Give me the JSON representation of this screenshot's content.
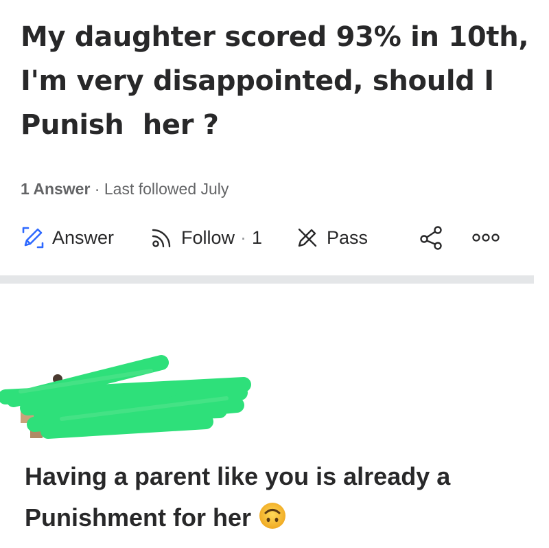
{
  "question": {
    "lines": [
      "My daughter scored 93% in 10th,",
      "I'm very disappointed, should I",
      "Punish  her ?"
    ]
  },
  "meta": {
    "answer_count": "1 Answer",
    "separator": " · ",
    "last_followed": "Last followed July"
  },
  "actions": {
    "answer_label": "Answer",
    "follow_label": "Follow",
    "follow_separator": "·",
    "follow_count": "1",
    "pass_label": "Pass",
    "icons": {
      "answer": "pencil-edit-icon",
      "follow": "rss-follow-icon",
      "pass": "pencil-crossed-icon",
      "share": "share-icon",
      "more": "more-options-icon"
    }
  },
  "answer": {
    "lines": [
      "Having a parent like you is already a",
      "Punishment for her"
    ],
    "emoji": "upside-down-face-icon"
  },
  "colors": {
    "text": "#282829",
    "meta_text": "#636466",
    "accent_blue": "#2e69ff",
    "divider": "#e4e6e8",
    "redaction_green": "#2ee07a",
    "emoji_yellow": "#f6c23a"
  }
}
